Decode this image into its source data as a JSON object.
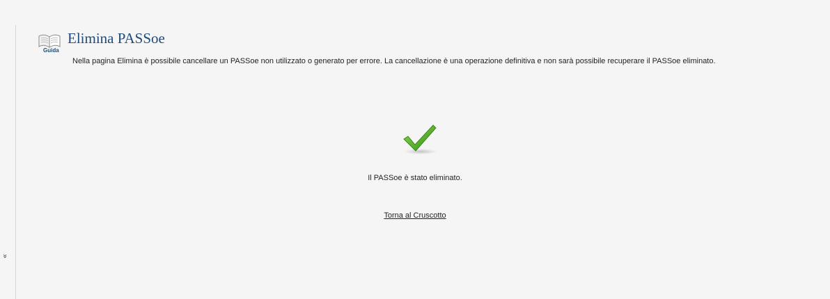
{
  "header": {
    "guide_label": "Guida",
    "title": "Elimina PASSoe",
    "guide_icon": "open-book-icon"
  },
  "intro": {
    "text": "Nella pagina Elimina è possibile cancellare un PASSoe non utilizzato o generato per errore. La cancellazione è una operazione definitiva e non sarà possibile recuperare il PASSoe eliminato."
  },
  "result": {
    "icon": "checkmark-icon",
    "icon_color": "#4caf2a",
    "message": "Il PASSoe è stato eliminato."
  },
  "actions": {
    "back_label": "Torna al Cruscotto"
  },
  "sidebar": {
    "glyph": "»"
  },
  "colors": {
    "title": "#1f4a7a",
    "background": "#f5f5f5"
  }
}
